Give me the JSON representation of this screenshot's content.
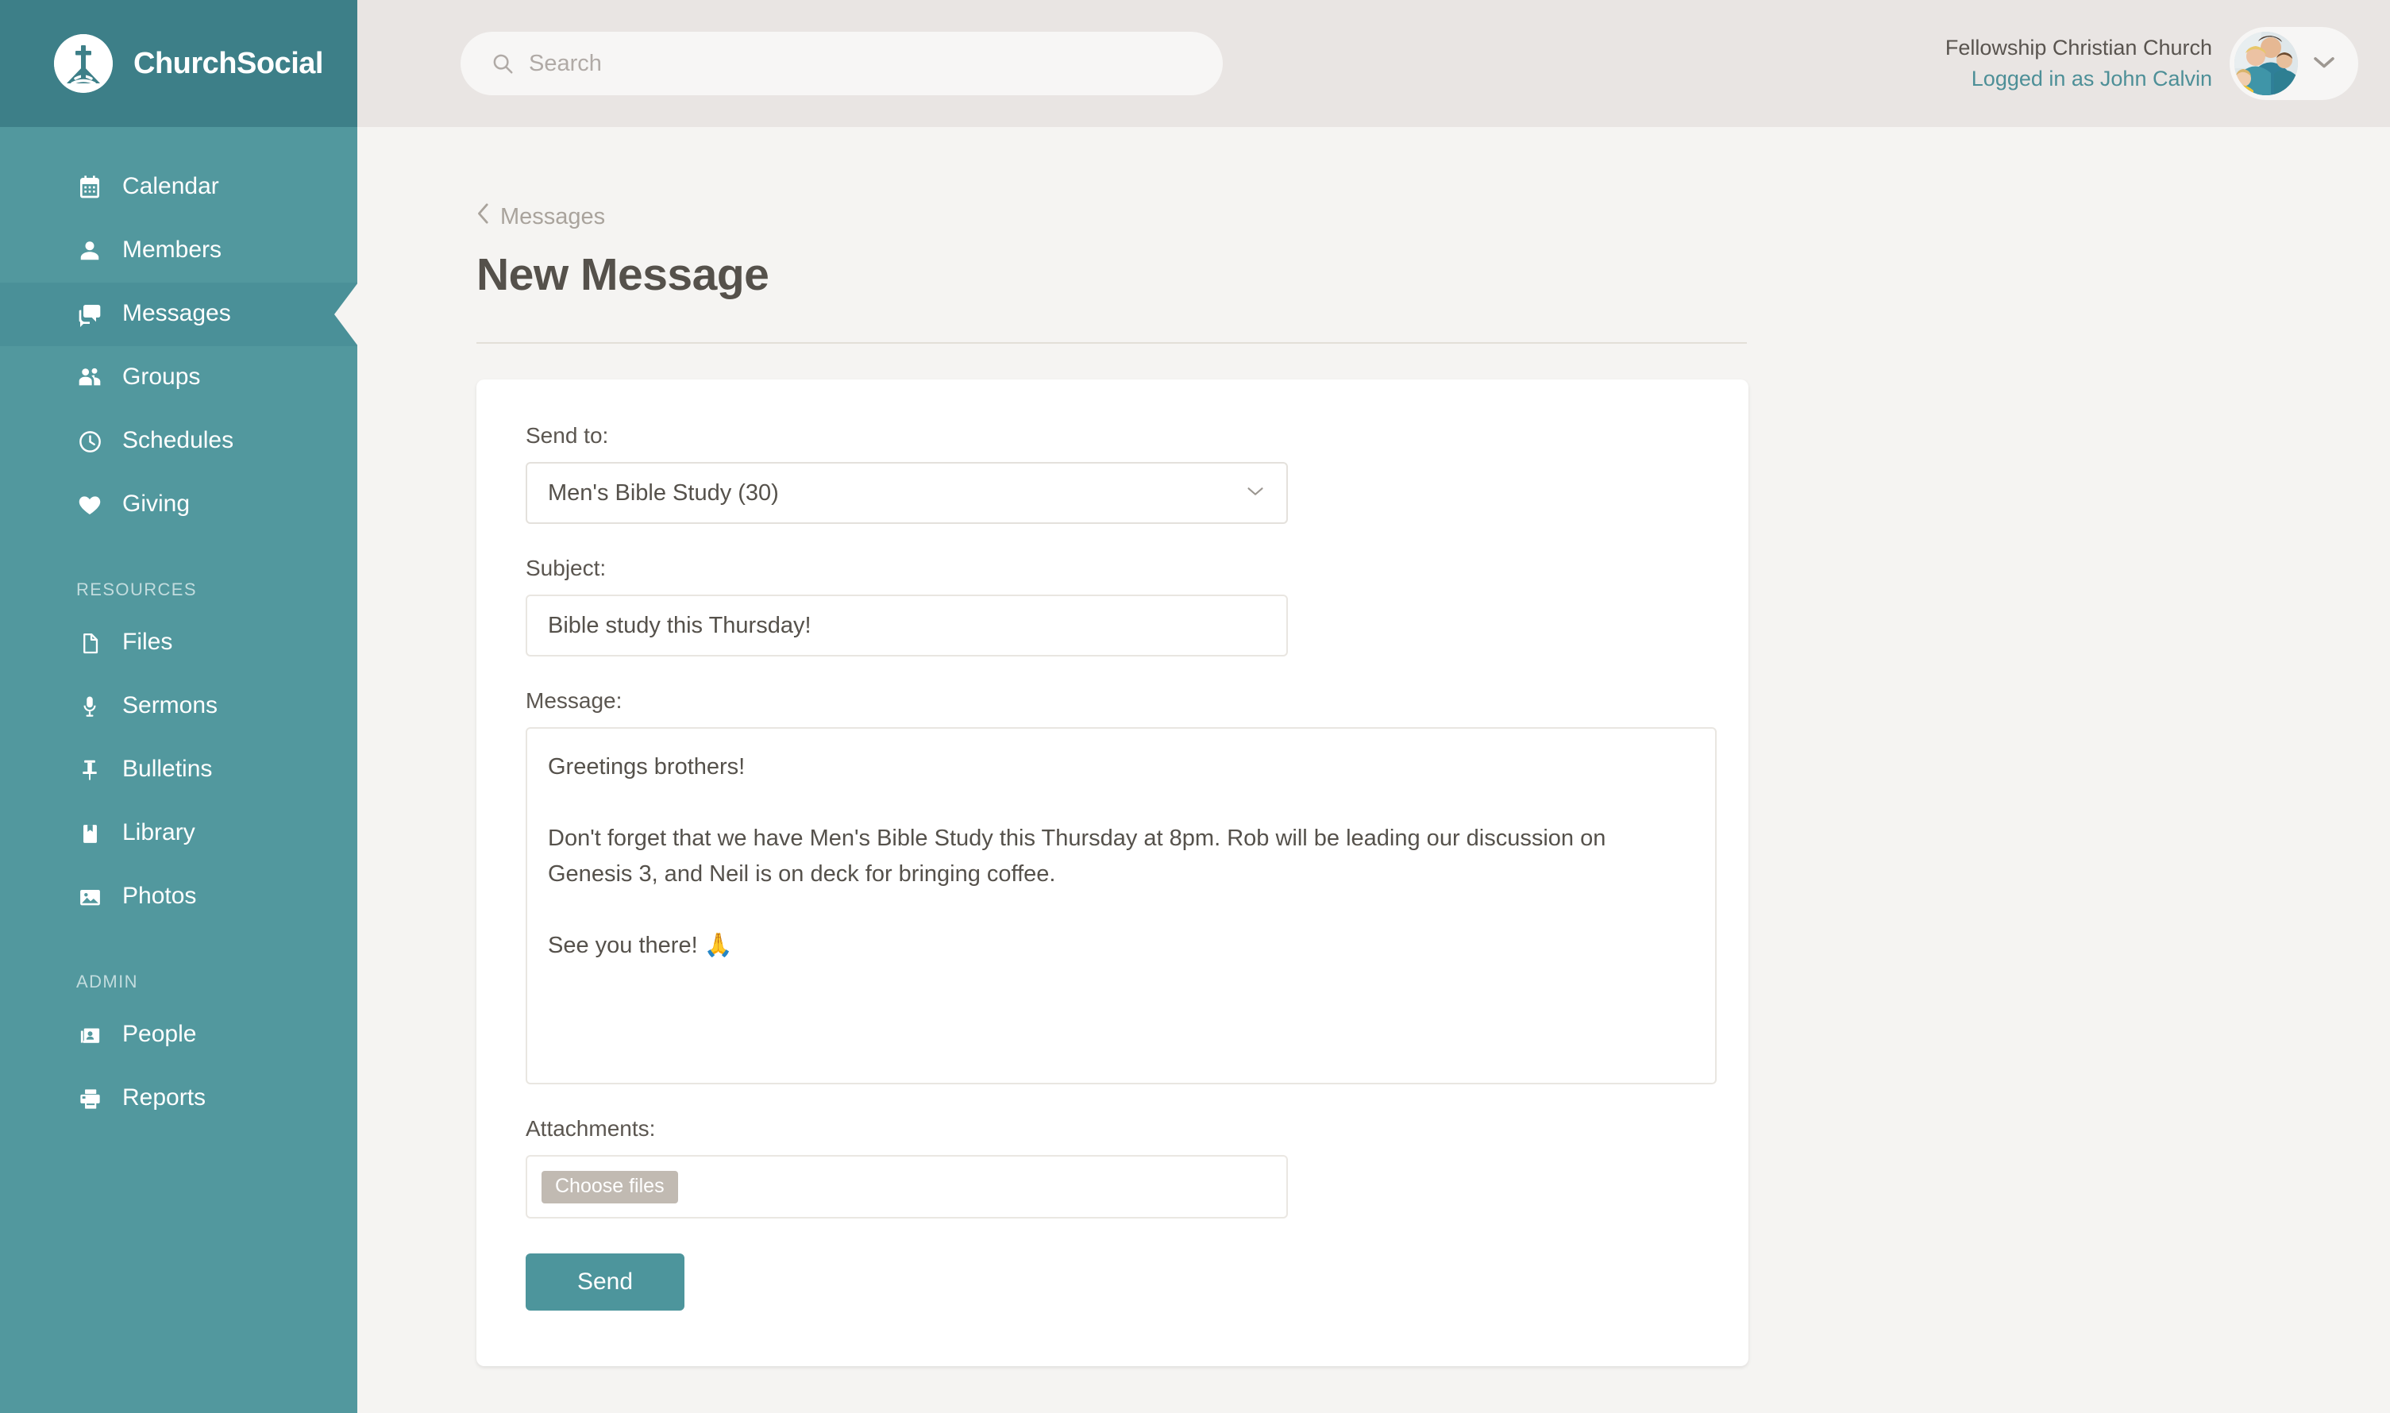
{
  "brand": {
    "name": "ChurchSocial",
    "logo_icon": "church-cross-logo-icon",
    "header_color": "#3d7f88",
    "sidebar_color": "#52989e",
    "accent_color": "#4d959c"
  },
  "search": {
    "placeholder": "Search",
    "icon": "search-icon",
    "value": ""
  },
  "account": {
    "church_name": "Fellowship Christian Church",
    "logged_in_as": "Logged in as John Calvin",
    "avatar_icon": "user-avatar",
    "chevron_icon": "chevron-down-icon"
  },
  "sidebar": {
    "primary": [
      {
        "label": "Calendar",
        "icon": "calendar-icon",
        "active": false
      },
      {
        "label": "Members",
        "icon": "person-icon",
        "active": false
      },
      {
        "label": "Messages",
        "icon": "chat-bubbles-icon",
        "active": true
      },
      {
        "label": "Groups",
        "icon": "people-group-icon",
        "active": false
      },
      {
        "label": "Schedules",
        "icon": "clock-icon",
        "active": false
      },
      {
        "label": "Giving",
        "icon": "heart-icon",
        "active": false
      }
    ],
    "resources_heading": "RESOURCES",
    "resources": [
      {
        "label": "Files",
        "icon": "file-icon"
      },
      {
        "label": "Sermons",
        "icon": "microphone-icon"
      },
      {
        "label": "Bulletins",
        "icon": "pushpin-icon"
      },
      {
        "label": "Library",
        "icon": "book-icon"
      },
      {
        "label": "Photos",
        "icon": "photo-icon"
      }
    ],
    "admin_heading": "ADMIN",
    "admin": [
      {
        "label": "People",
        "icon": "id-card-icon"
      },
      {
        "label": "Reports",
        "icon": "printer-icon"
      }
    ]
  },
  "page": {
    "breadcrumb": "Messages",
    "breadcrumb_icon": "chevron-left-icon",
    "title": "New Message"
  },
  "form": {
    "send_to": {
      "label": "Send to:",
      "value": "Men's Bible Study (30)",
      "chevron_icon": "chevron-down-icon"
    },
    "subject": {
      "label": "Subject:",
      "value": "Bible study this Thursday!",
      "placeholder": ""
    },
    "message": {
      "label": "Message:",
      "value": "Greetings brothers!\n\nDon't forget that we have Men's Bible Study this Thursday at 8pm. Rob will be leading our discussion on Genesis 3, and Neil is on deck for bringing coffee.\n\nSee you there! 🙏",
      "placeholder": ""
    },
    "attachments": {
      "label": "Attachments:",
      "choose_files_label": "Choose files",
      "selected": ""
    },
    "submit_label": "Send"
  }
}
